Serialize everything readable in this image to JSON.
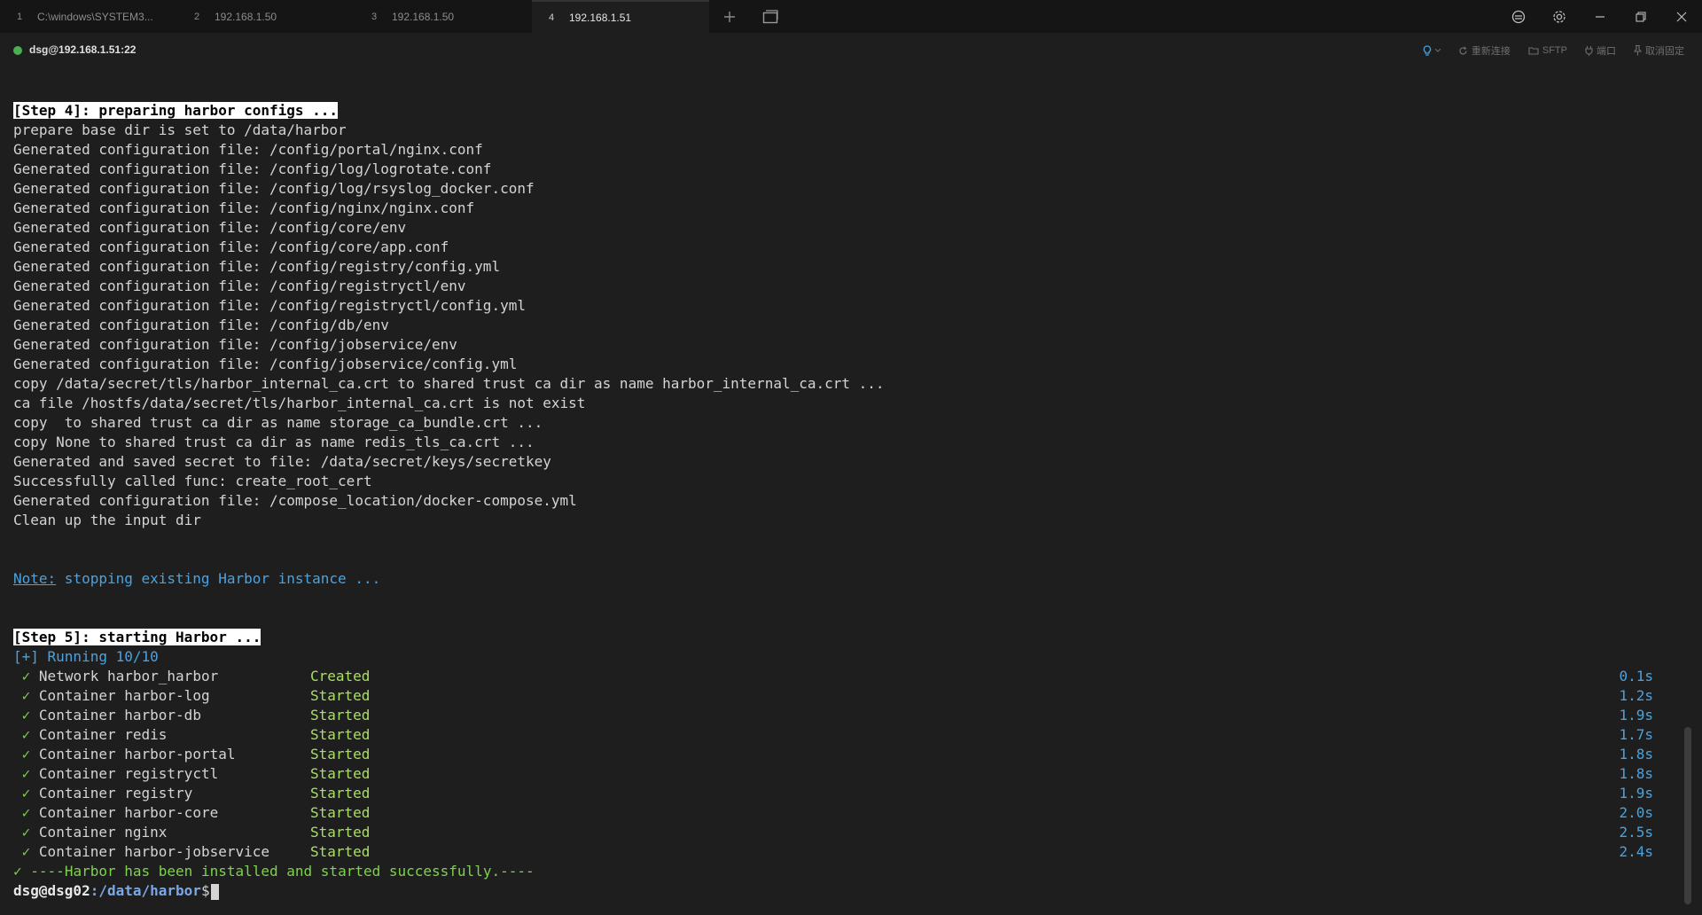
{
  "tabs": [
    {
      "num": "1",
      "label": "C:\\windows\\SYSTEM3..."
    },
    {
      "num": "2",
      "label": "192.168.1.50"
    },
    {
      "num": "3",
      "label": "192.168.1.50"
    },
    {
      "num": "4",
      "label": "192.168.1.51"
    }
  ],
  "session": {
    "label": "dsg@192.168.1.51:22",
    "tools": {
      "reconnect": "重新连接",
      "sftp": "SFTP",
      "port": "端口",
      "unpin": "取消固定"
    }
  },
  "terminal": {
    "step4_header": "[Step 4]: preparing harbor configs ...",
    "step4_lines": [
      "prepare base dir is set to /data/harbor",
      "Generated configuration file: /config/portal/nginx.conf",
      "Generated configuration file: /config/log/logrotate.conf",
      "Generated configuration file: /config/log/rsyslog_docker.conf",
      "Generated configuration file: /config/nginx/nginx.conf",
      "Generated configuration file: /config/core/env",
      "Generated configuration file: /config/core/app.conf",
      "Generated configuration file: /config/registry/config.yml",
      "Generated configuration file: /config/registryctl/env",
      "Generated configuration file: /config/registryctl/config.yml",
      "Generated configuration file: /config/db/env",
      "Generated configuration file: /config/jobservice/env",
      "Generated configuration file: /config/jobservice/config.yml",
      "copy /data/secret/tls/harbor_internal_ca.crt to shared trust ca dir as name harbor_internal_ca.crt ...",
      "ca file /hostfs/data/secret/tls/harbor_internal_ca.crt is not exist",
      "copy  to shared trust ca dir as name storage_ca_bundle.crt ...",
      "copy None to shared trust ca dir as name redis_tls_ca.crt ...",
      "Generated and saved secret to file: /data/secret/keys/secretkey",
      "Successfully called func: create_root_cert",
      "Generated configuration file: /compose_location/docker-compose.yml",
      "Clean up the input dir"
    ],
    "note_label": "Note:",
    "note_text": " stopping existing Harbor instance ...",
    "step5_header": "[Step 5]: starting Harbor ...",
    "running": "[+] Running 10/10",
    "containers": [
      {
        "name": "Network harbor_harbor",
        "status": "Created",
        "time": "0.1s"
      },
      {
        "name": "Container harbor-log",
        "status": "Started",
        "time": "1.2s"
      },
      {
        "name": "Container harbor-db",
        "status": "Started",
        "time": "1.9s"
      },
      {
        "name": "Container redis",
        "status": "Started",
        "time": "1.7s"
      },
      {
        "name": "Container harbor-portal",
        "status": "Started",
        "time": "1.8s"
      },
      {
        "name": "Container registryctl",
        "status": "Started",
        "time": "1.8s"
      },
      {
        "name": "Container registry",
        "status": "Started",
        "time": "1.9s"
      },
      {
        "name": "Container harbor-core",
        "status": "Started",
        "time": "2.0s"
      },
      {
        "name": "Container nginx",
        "status": "Started",
        "time": "2.5s"
      },
      {
        "name": "Container harbor-jobservice",
        "status": "Started",
        "time": "2.4s"
      }
    ],
    "success": "----Harbor has been installed and started successfully.----",
    "check_glyph": "✓",
    "prompt_user": "dsg@dsg02",
    "prompt_path": ":/data/harbor",
    "prompt_symbol": "$"
  }
}
